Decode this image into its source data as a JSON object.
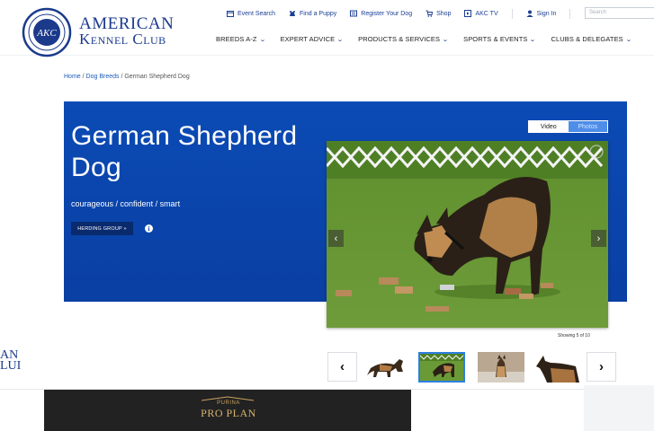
{
  "header": {
    "logo": {
      "line1": "American",
      "line2": "Kennel Club",
      "seal_text": "AKC"
    },
    "util_nav": [
      {
        "label": "Event Search",
        "icon": "calendar-icon"
      },
      {
        "label": "Find a Puppy",
        "icon": "dog-icon"
      },
      {
        "label": "Register Your Dog",
        "icon": "register-icon"
      },
      {
        "label": "Shop",
        "icon": "cart-icon"
      },
      {
        "label": "AKC TV",
        "icon": "play-icon"
      },
      {
        "label": "Sign In",
        "icon": "user-icon"
      }
    ],
    "search_placeholder": "Search",
    "main_nav": [
      {
        "label": "BREEDS A-Z"
      },
      {
        "label": "EXPERT ADVICE"
      },
      {
        "label": "PRODUCTS & SERVICES"
      },
      {
        "label": "SPORTS & EVENTS"
      },
      {
        "label": "CLUBS & DELEGATES"
      }
    ]
  },
  "breadcrumb": {
    "home": "Home",
    "sep1": " / ",
    "dog_breeds": "Dog Breeds",
    "sep2": " / ",
    "current": "German Shepherd Dog"
  },
  "hero": {
    "title": "German Shepherd Dog",
    "traits": "courageous / confident / smart",
    "group_button": "HERDING GROUP »",
    "info_icon": "i",
    "media_toggle": {
      "video": "Video",
      "photos": "Photos",
      "selected": "Photos"
    },
    "showing": "Showing 5 of 10"
  },
  "side_logo": {
    "line1": "AN",
    "line2": "LUI"
  },
  "thumbnails": {
    "prev": "‹",
    "next": "›",
    "selected_index": 1
  },
  "ad": {
    "purina": "PURINA",
    "proplan": "PRO PLAN"
  },
  "colors": {
    "brand_blue": "#1b3a8c",
    "hero_blue": "#0b4bb5",
    "link_blue": "#1c5bb8",
    "ad_gold": "#d8b56e"
  }
}
